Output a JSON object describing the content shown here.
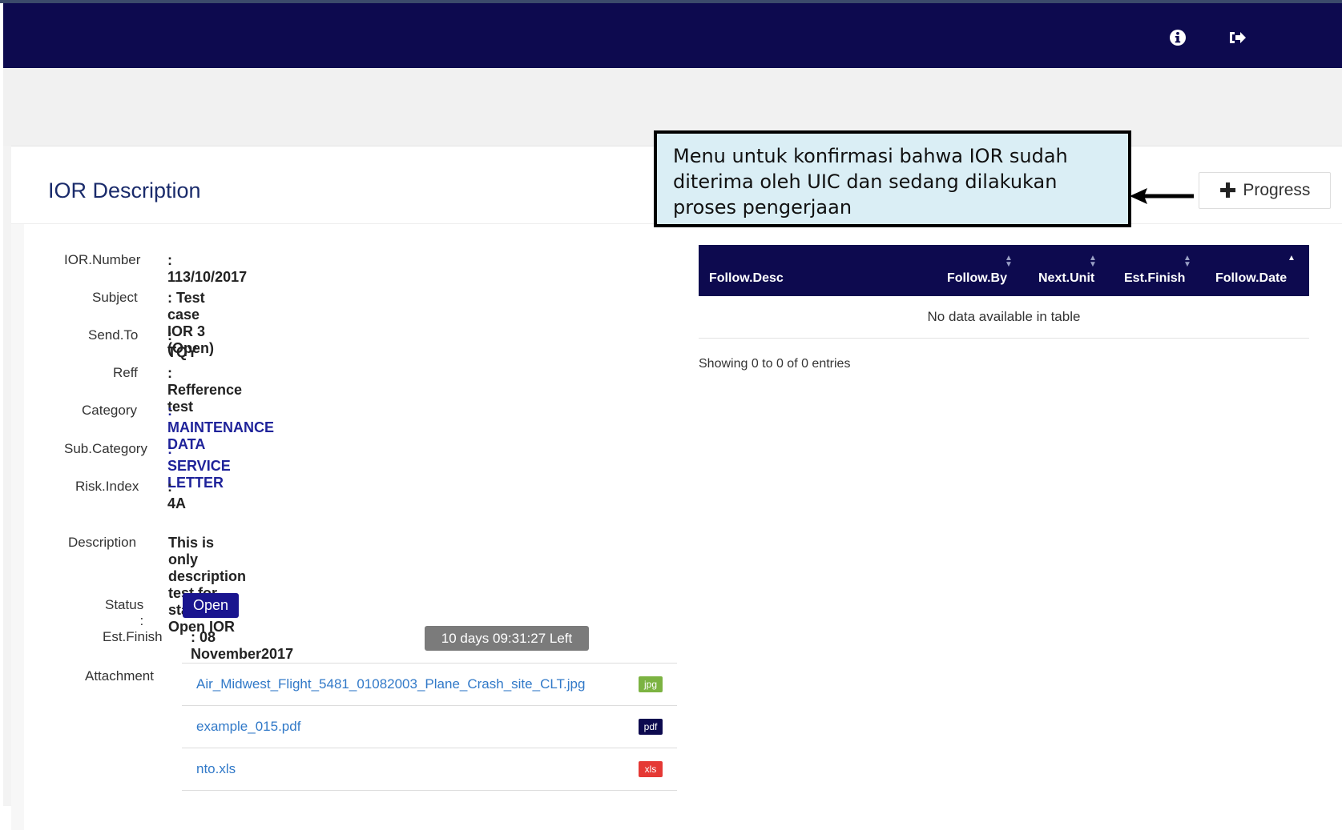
{
  "navbar": {
    "info_icon": "info-circle-icon",
    "logout_icon": "sign-out-icon"
  },
  "panel": {
    "title": "IOR Description",
    "progress_button_label": "Progress",
    "progress_button_icon": "plus-icon"
  },
  "callout": {
    "text": "Menu untuk konfirmasi bahwa IOR sudah diterima oleh UIC dan sedang dilakukan proses pengerjaan"
  },
  "fields": {
    "ior_number": {
      "label": "IOR.Number",
      "value": ": 113/10/2017"
    },
    "subject": {
      "label": "Subject",
      "value": ": Test case IOR 3 (Open)"
    },
    "send_to": {
      "label": "Send.To",
      "value": ": TQY"
    },
    "reff": {
      "label": "Reff",
      "value": ": Refference test"
    },
    "category": {
      "label": "Category",
      "value": ": MAINTENANCE DATA"
    },
    "sub_category": {
      "label": "Sub.Category",
      "value": ": SERVICE LETTER"
    },
    "risk_index": {
      "label": "Risk.Index",
      "value": ": 4A"
    },
    "description": {
      "label": "Description",
      "value": "This is only description test for status Open IOR"
    },
    "status": {
      "label": "Status :",
      "value": "Open"
    },
    "est_finish": {
      "label": "Est.Finish",
      "value": ": 08 November2017",
      "countdown": "10 days 09:31:27 Left"
    },
    "attachment": {
      "label": "Attachment"
    }
  },
  "attachments": [
    {
      "name": "Air_Midwest_Flight_5481_01082003_Plane_Crash_site_CLT.jpg",
      "type": "jpg",
      "color": "#7cb342"
    },
    {
      "name": "example_015.pdf",
      "type": "pdf",
      "color": "#0d0a4f"
    },
    {
      "name": "nto.xls",
      "type": "xls",
      "color": "#e53935"
    }
  ],
  "follow_table": {
    "columns": [
      "Follow.Desc",
      "Follow.By",
      "Next.Unit",
      "Est.Finish",
      "Follow.Date"
    ],
    "empty_text": "No data available in table",
    "info": "Showing 0 to 0 of 0 entries"
  },
  "colors": {
    "navbar": "#0d0a4f",
    "title": "#1a2b6b",
    "status_badge": "#1a158f",
    "link": "#3179c8",
    "callout_bg": "#daeef5"
  }
}
